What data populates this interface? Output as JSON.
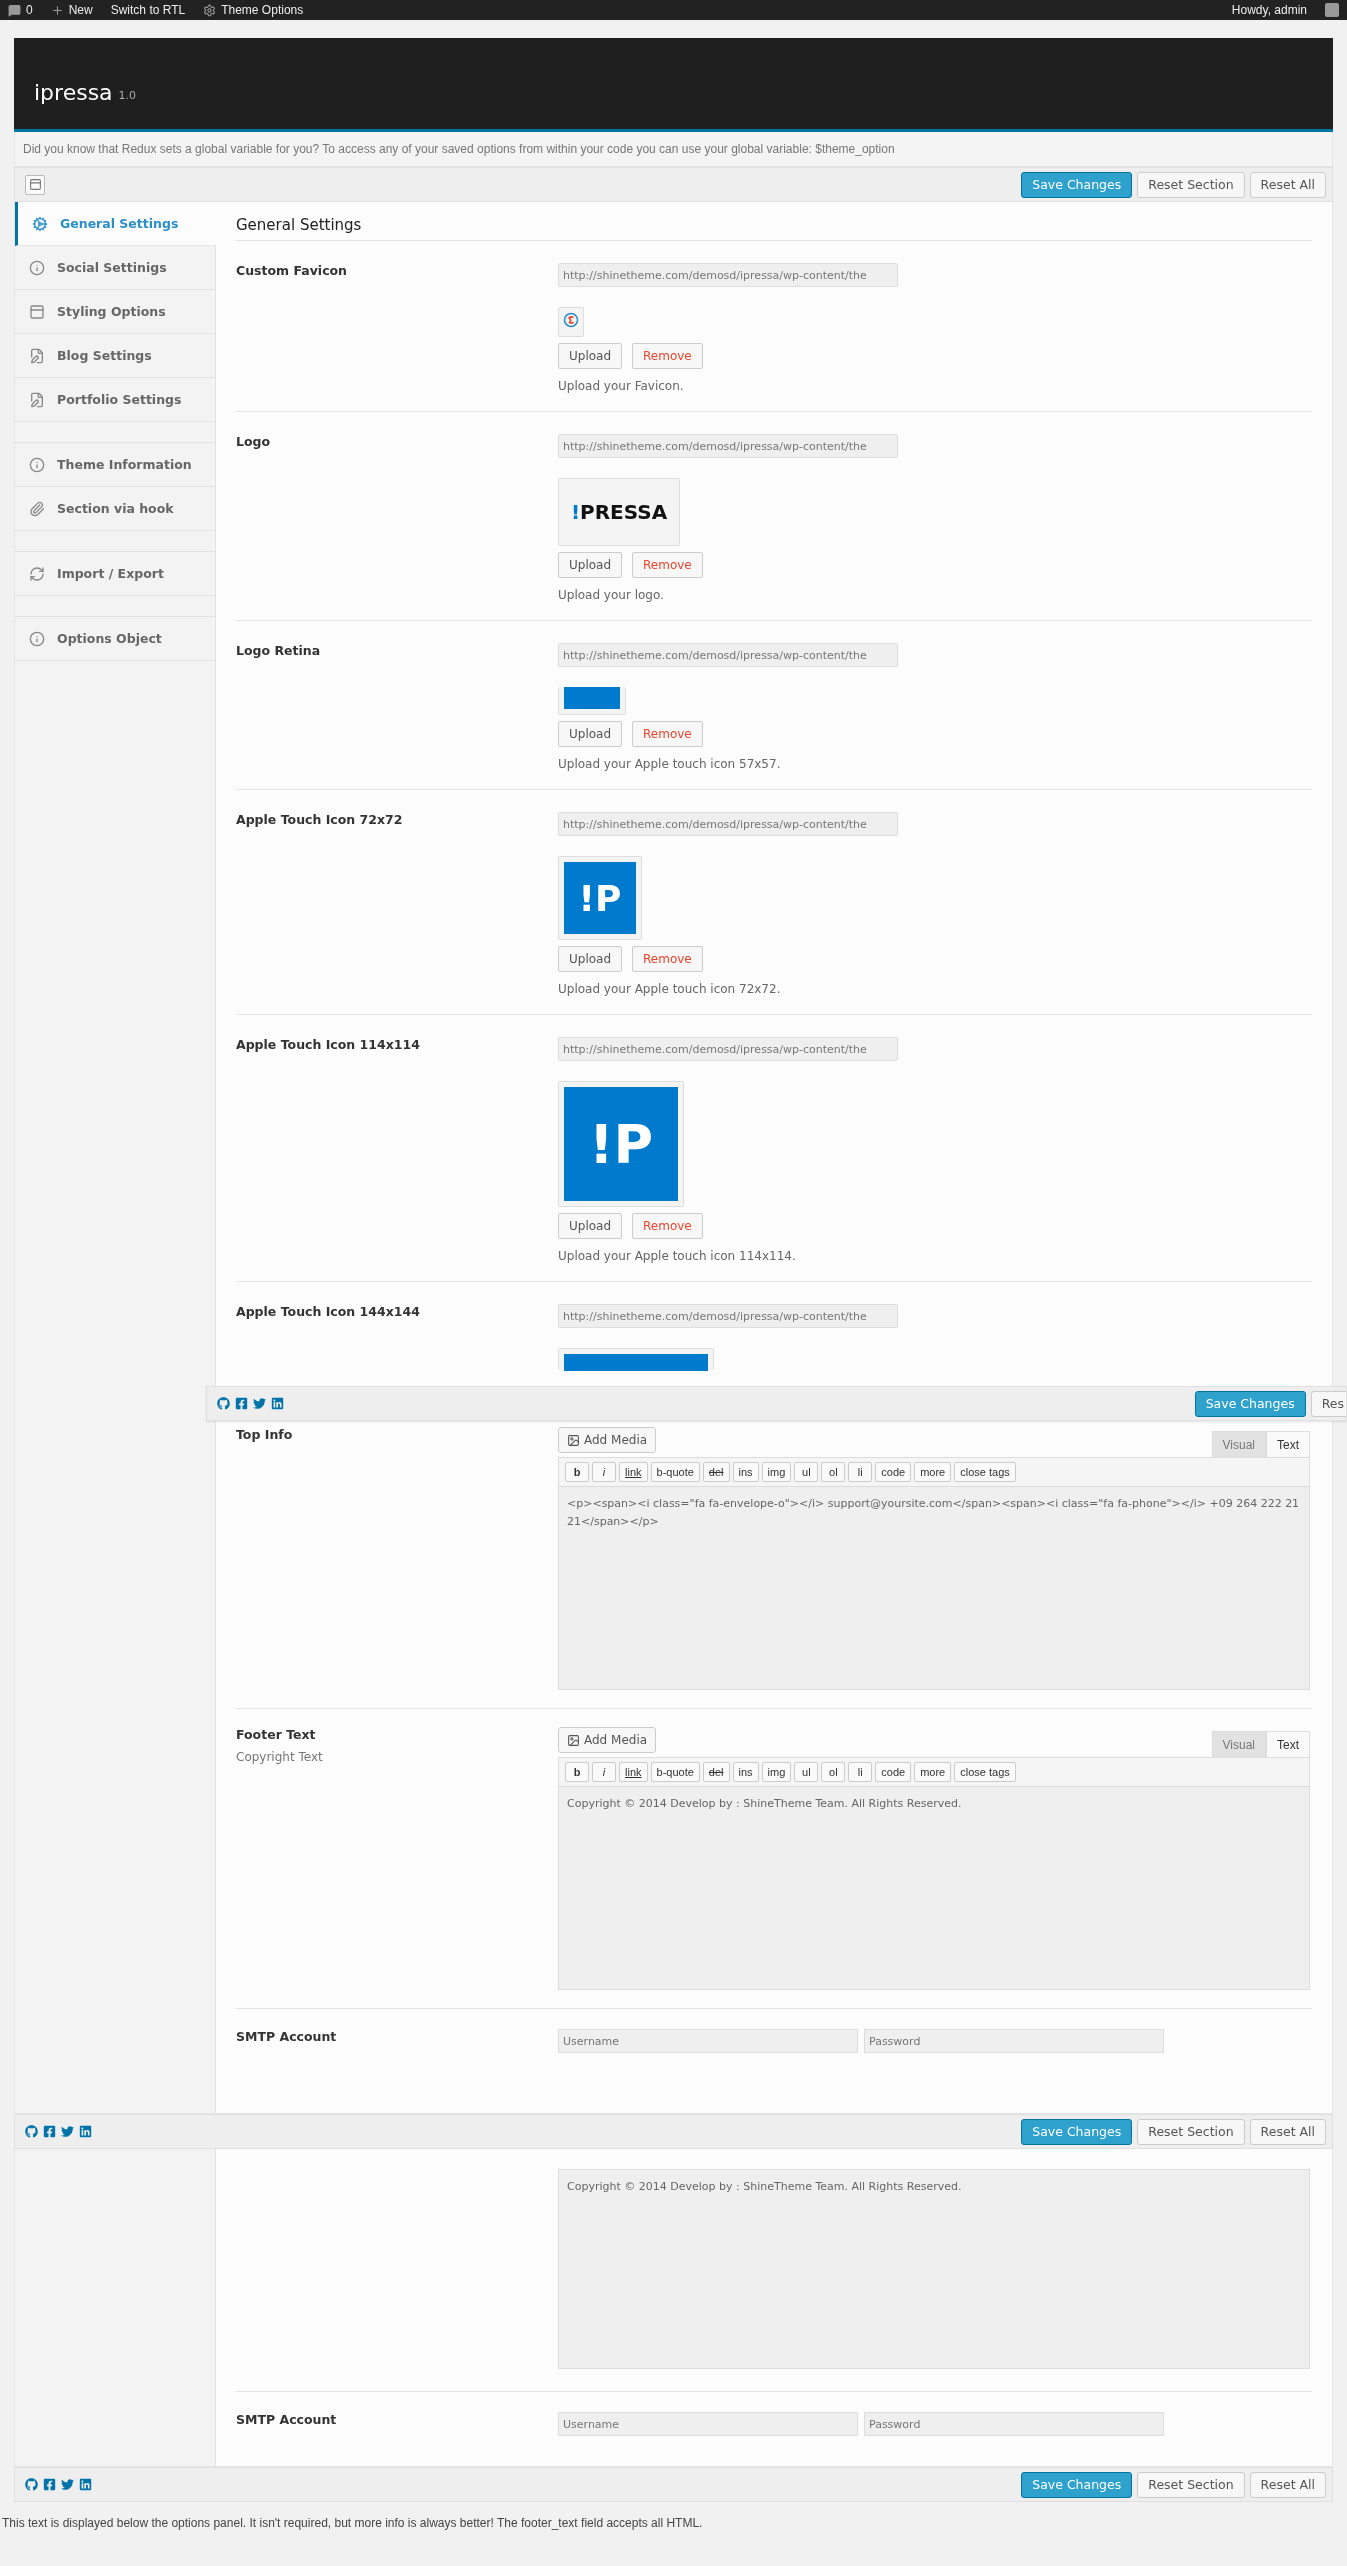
{
  "admin_bar": {
    "items": [
      {
        "kind": "comments",
        "label": "0"
      },
      {
        "kind": "new",
        "label": "New"
      },
      {
        "kind": "plain",
        "label": "Switch to RTL"
      },
      {
        "kind": "settings",
        "label": "Theme Options"
      }
    ],
    "greeting": "Howdy, admin"
  },
  "header": {
    "title": "ipressa",
    "version": "1.0"
  },
  "notice": "Did you know that Redux sets a global variable for you? To access any of your saved options from within your code you can use your global variable: $theme_option",
  "toolbar": {
    "buttons": [
      {
        "kind": "primary",
        "label": "Save Changes"
      },
      {
        "kind": "secondary",
        "label": "Reset Section"
      },
      {
        "kind": "secondary",
        "label": "Reset All"
      }
    ]
  },
  "sidebar": {
    "groups": [
      [
        {
          "label": "General Settings",
          "selected": true
        },
        {
          "label": "Social Settinigs",
          "selected": false
        },
        {
          "label": "Styling Options",
          "selected": false
        },
        {
          "label": "Blog Settings",
          "selected": false
        },
        {
          "label": "Portfolio Settings",
          "selected": false
        }
      ],
      [
        {
          "label": "Theme Information",
          "selected": false
        },
        {
          "label": "Section via hook",
          "selected": false
        }
      ],
      [
        {
          "label": "Import / Export",
          "selected": false
        }
      ],
      [
        {
          "label": "Options Object",
          "selected": false
        }
      ]
    ]
  },
  "section_title": "General Settings",
  "fields": [
    {
      "kind": "media",
      "label": "Custom Favicon",
      "url": "http://shinetheme.com/demosd/ipressa/wp-content/the",
      "preview": {
        "kind": "favicon"
      },
      "upload": "Upload",
      "remove": "Remove",
      "description": "Upload your Favicon."
    },
    {
      "kind": "media",
      "label": "Logo",
      "url": "http://shinetheme.com/demosd/ipressa/wp-content/the",
      "preview": {
        "kind": "wordmark",
        "mark": "!",
        "text": "PRESSA"
      },
      "upload": "Upload",
      "remove": "Remove",
      "description": "Upload your logo."
    },
    {
      "kind": "media",
      "label": "Logo Retina",
      "url": "http://shinetheme.com/demosd/ipressa/wp-content/the",
      "preview": {
        "kind": "cropped"
      },
      "upload": "Upload",
      "remove": "Remove",
      "description": "Upload your Apple touch icon 57x57."
    },
    {
      "kind": "media",
      "label": "Apple Touch Icon 72x72",
      "url": "http://shinetheme.com/demosd/ipressa/wp-content/the",
      "preview": {
        "kind": "tile_small",
        "text": "!P"
      },
      "upload": "Upload",
      "remove": "Remove",
      "description": "Upload your Apple touch icon 72x72."
    },
    {
      "kind": "media",
      "label": "Apple Touch Icon 114x114",
      "url": "http://shinetheme.com/demosd/ipressa/wp-content/the",
      "preview": {
        "kind": "tile_large",
        "text": "!P"
      },
      "upload": "Upload",
      "remove": "Remove",
      "description": "Upload your Apple touch icon 114x114."
    },
    {
      "kind": "media_cut",
      "label": "Apple Touch Icon 144x144",
      "url": "http://shinetheme.com/demosd/ipressa/wp-content/the",
      "preview": {
        "kind": "blank"
      }
    }
  ],
  "floating_bar": {
    "buttons": [
      {
        "kind": "primary",
        "label": "Save Changes"
      },
      {
        "kind": "cut",
        "label": "Res"
      }
    ]
  },
  "editors": [
    {
      "kind": "editor",
      "label": "Top Info",
      "add_media": "Add Media",
      "tabs": [
        {
          "label": "Visual",
          "selected": false
        },
        {
          "label": "Text",
          "selected": true
        }
      ],
      "quicktags": [
        "b",
        "i",
        "link",
        "b-quote",
        "del",
        "ins",
        "img",
        "ul",
        "ol",
        "li",
        "code",
        "more",
        "close tags"
      ],
      "content": "<p><span><i class=\"fa fa-envelope-o\"></i> support@yoursite.com</span><span><i class=\"fa fa-phone\"></i> +09 264 222 21 21</span></p>"
    },
    {
      "kind": "editor",
      "label": "Footer Text",
      "sublabel": "Copyright Text",
      "add_media": "Add Media",
      "tabs": [
        {
          "label": "Visual",
          "selected": false
        },
        {
          "label": "Text",
          "selected": true
        }
      ],
      "quicktags": [
        "b",
        "i",
        "link",
        "b-quote",
        "del",
        "ins",
        "img",
        "ul",
        "ol",
        "li",
        "code",
        "more",
        "close tags"
      ],
      "content": "Copyright © 2014 Develop by : ShineTheme Team. All Rights Reserved."
    },
    {
      "kind": "login",
      "label": "SMTP Account",
      "username_placeholder": "Username",
      "password_placeholder": "Password"
    }
  ],
  "sticky_bar": {
    "buttons": [
      {
        "kind": "primary",
        "label": "Save Changes"
      },
      {
        "kind": "secondary",
        "label": "Reset Section"
      },
      {
        "kind": "secondary",
        "label": "Reset All"
      }
    ]
  },
  "repeat": {
    "content": "Copyright © 2014 Develop by : ShineTheme Team. All Rights Reserved.",
    "smtp": {
      "label": "SMTP Account",
      "username_placeholder": "Username",
      "password_placeholder": "Password"
    }
  },
  "bottom_bar": {
    "buttons": [
      {
        "kind": "primary",
        "label": "Save Changes"
      },
      {
        "kind": "secondary",
        "label": "Reset Section"
      },
      {
        "kind": "secondary",
        "label": "Reset All"
      }
    ]
  },
  "footer_note": "This text is displayed below the options panel. It isn't required, but more info is always better! The footer_text field accepts all HTML."
}
